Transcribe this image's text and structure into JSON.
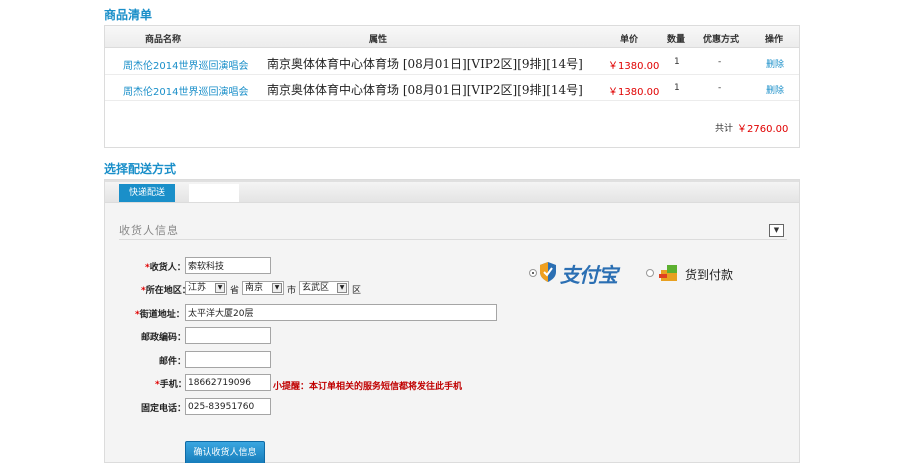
{
  "goods_section": {
    "title": "商品清单",
    "headers": {
      "name": "商品名称",
      "property": "属性",
      "price": "单价",
      "quantity": "数量",
      "discount": "优惠方式",
      "action": "操作"
    },
    "rows": [
      {
        "name": "周杰伦2014世界巡回演唱会",
        "property": "南京奥体体育中心体育场 [08月01日][VIP2区][9排][14号]",
        "price": "￥1380.00",
        "quantity": "1",
        "discount": "-",
        "action": "删除"
      },
      {
        "name": "周杰伦2014世界巡回演唱会",
        "property": "南京奥体体育中心体育场 [08月01日][VIP2区][9排][14号]",
        "price": "￥1380.00",
        "quantity": "1",
        "discount": "-",
        "action": "删除"
      }
    ],
    "total_label": "共计",
    "total_value": "￥2760.00"
  },
  "delivery_section": {
    "title": "选择配送方式",
    "tabs": [
      "快递配送"
    ],
    "receiver_title": "收货人信息",
    "fields": {
      "name_label": "收货人：",
      "name_value": "索软科技",
      "region_label": "所在地区：",
      "province": "江苏",
      "province_unit": "省",
      "city": "南京",
      "city_unit": "市",
      "district": "玄武区",
      "district_unit": "区",
      "street_label": "街道地址：",
      "street_value": "太平洋大厦20层",
      "postcode_label": "邮政编码：",
      "postcode_value": "",
      "email_label": "邮件：",
      "email_value": "",
      "mobile_label": "手机：",
      "mobile_value": "18662719096",
      "tip": "小提醒：本订单相关的服务短信都将发往此手机",
      "phone_label": "固定电话：",
      "phone_value": "025-83951760"
    },
    "confirm_button": "确认收货人信息",
    "payment": {
      "alipay_logo_text": "支付宝",
      "cod_text": "货到付款",
      "selected": "alipay"
    }
  },
  "colors": {
    "accent": "#1a8fc9",
    "price_red": "#e00000",
    "tip_red": "#c00000"
  }
}
